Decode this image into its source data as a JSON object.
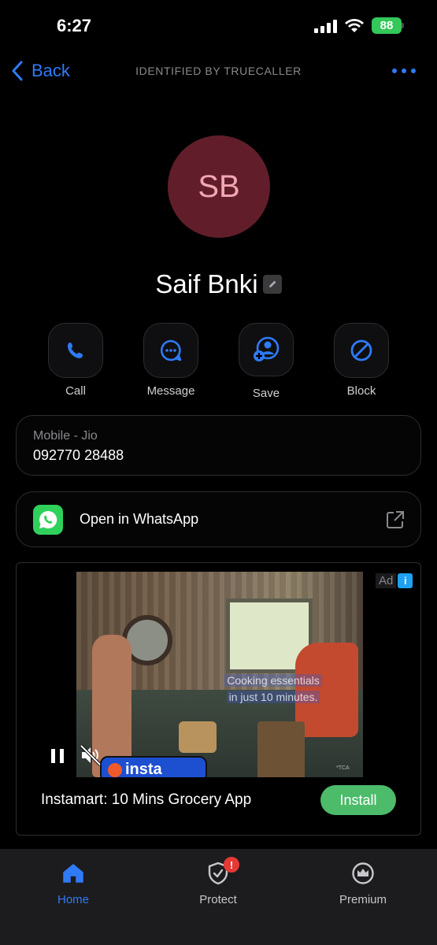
{
  "status_bar": {
    "time": "6:27",
    "battery": "88"
  },
  "nav": {
    "back_label": "Back",
    "title": "IDENTIFIED BY TRUECALLER"
  },
  "contact": {
    "initials": "SB",
    "name": "Saif Bnki",
    "avatar_color": "#611e2a"
  },
  "actions": [
    {
      "label": "Call",
      "icon": "phone-icon"
    },
    {
      "label": "Message",
      "icon": "message-icon"
    },
    {
      "label": "Save",
      "icon": "add-contact-icon"
    },
    {
      "label": "Block",
      "icon": "block-icon"
    }
  ],
  "phone": {
    "label": "Mobile - Jio",
    "number": "092770 28488"
  },
  "whatsapp": {
    "label": "Open in WhatsApp",
    "icon": "whatsapp-icon"
  },
  "ad": {
    "badge": "Ad",
    "info": "i",
    "caption_line1": "Cooking essentials",
    "caption_line2": "in just 10 minutes.",
    "brand": "insta",
    "tca": "*TCA",
    "title": "Instamart: 10 Mins Grocery App",
    "install_label": "Install"
  },
  "tabs": [
    {
      "label": "Home",
      "icon": "home-icon",
      "active": true
    },
    {
      "label": "Protect",
      "icon": "shield-icon",
      "badge": "!"
    },
    {
      "label": "Premium",
      "icon": "crown-icon"
    }
  ],
  "colors": {
    "accent": "#2f7bf6",
    "install": "#4cbb6a",
    "whatsapp": "#2fd15a",
    "battery": "#34c759"
  }
}
